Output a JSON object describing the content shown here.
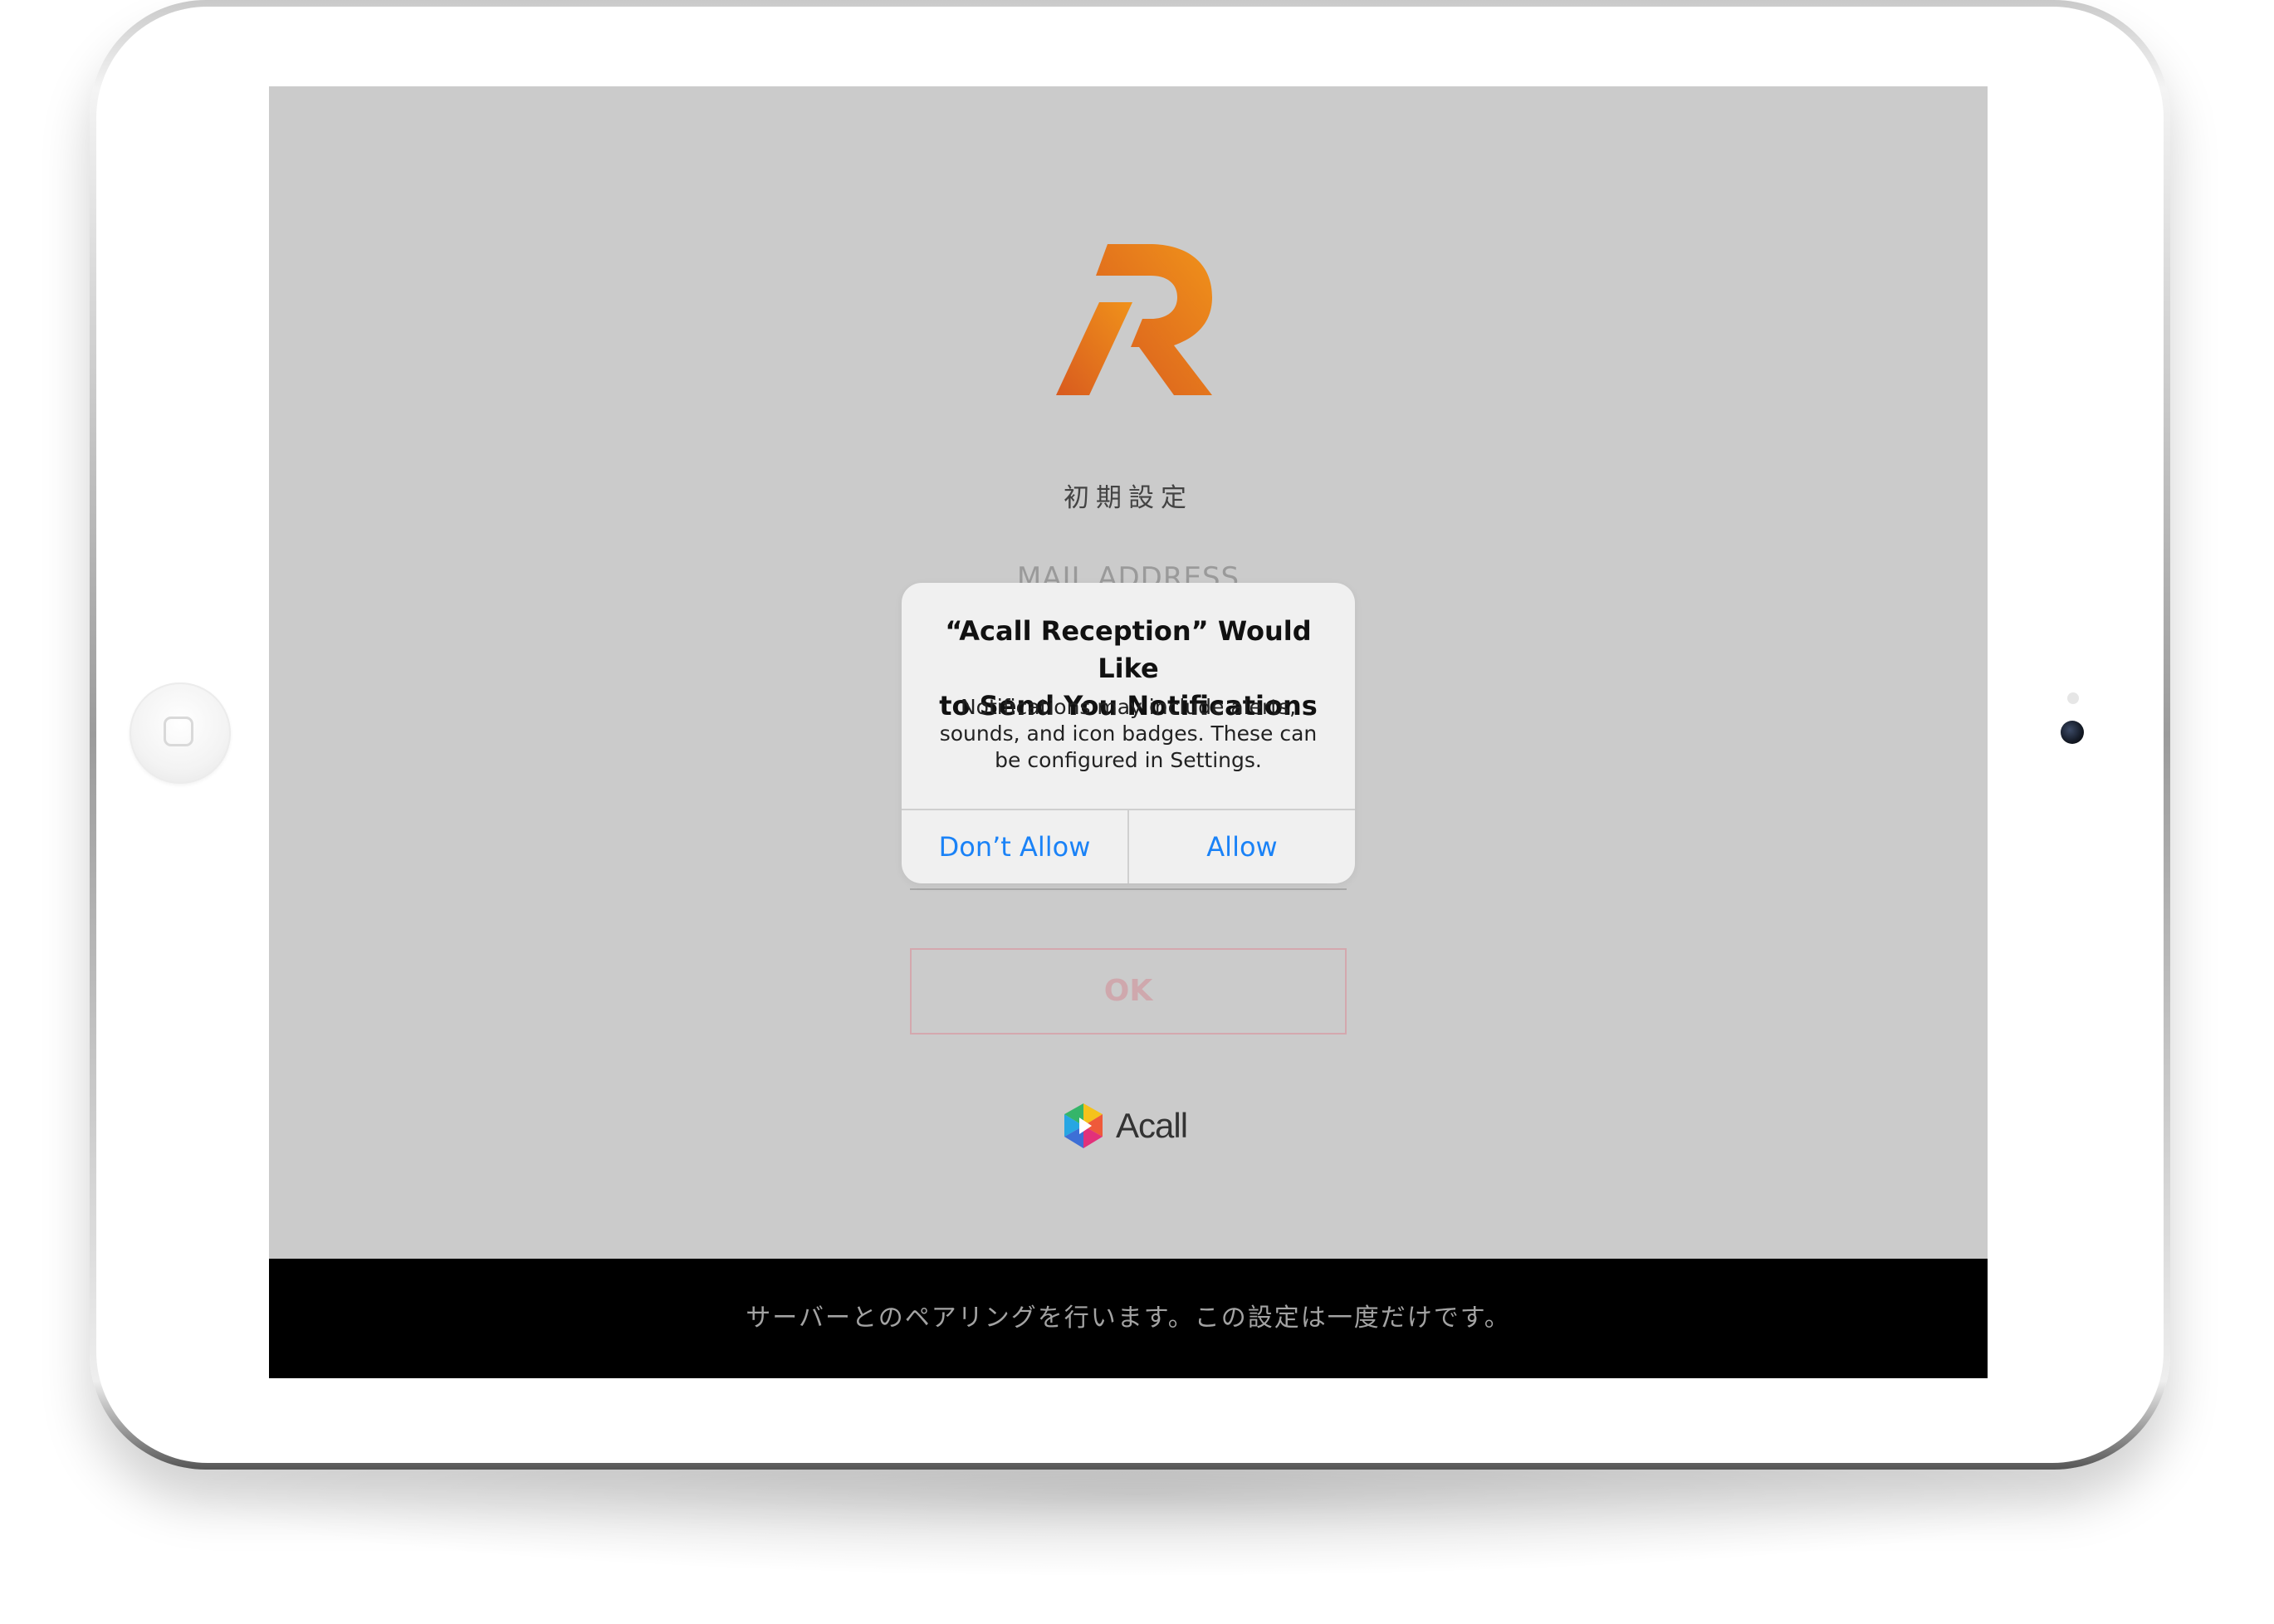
{
  "screen": {
    "setup_title": "初期設定",
    "mail_label": "MAIL ADDRESS",
    "ok_label": "OK",
    "brand_name": "Acall",
    "footer_text": "サーバーとのペアリングを行います。この設定は一度だけです。"
  },
  "alert": {
    "title_line1": "“Acall Reception” Would Like",
    "title_line2": "to Send You Notifications",
    "message_line1": "Notifications may include alerts,",
    "message_line2": "sounds, and icon badges. These can",
    "message_line3": "be configured in Settings.",
    "deny_label": "Don’t Allow",
    "allow_label": "Allow"
  },
  "icons": {
    "app_logo": "acall-reception-r-logo-icon",
    "brand_logo": "acall-hexagon-logo-icon",
    "home_button": "home-button-icon",
    "camera": "front-camera-icon"
  },
  "colors": {
    "screen_background": "#cbcbcb",
    "logo_orange_light": "#ef8a1a",
    "logo_orange_dark": "#dc5f1e",
    "ios_blue": "#1a82f7",
    "ok_border": "#d4a8ae",
    "footer_background": "#000000"
  }
}
